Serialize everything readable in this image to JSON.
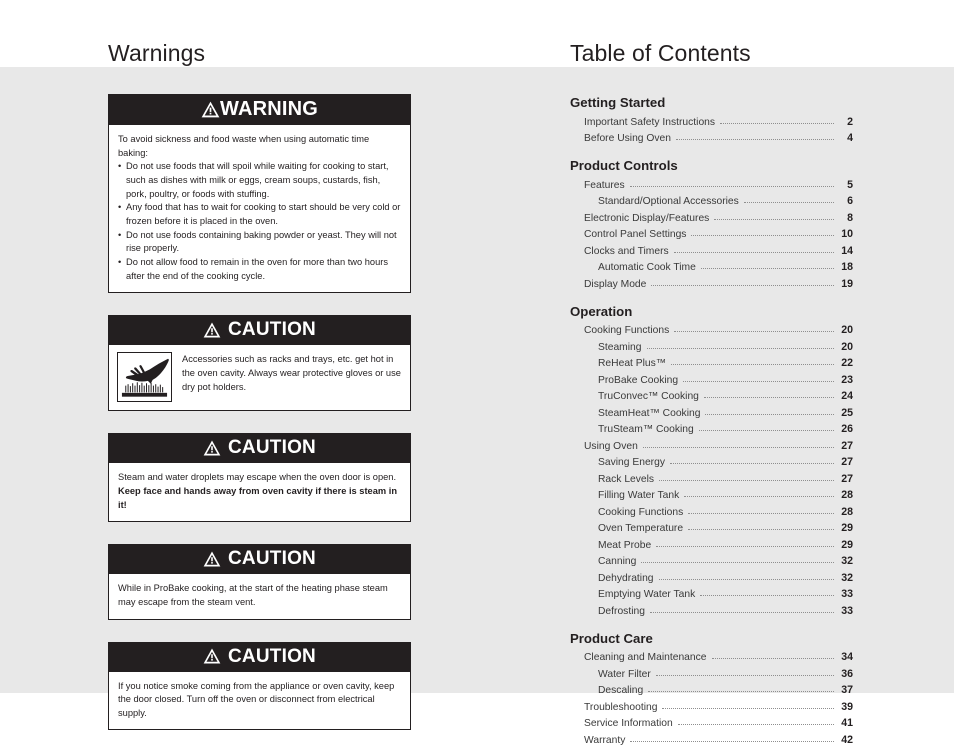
{
  "warnings": {
    "heading": "Warnings",
    "boxes": [
      {
        "level": "WARNING",
        "icon": "warning-triangle-icon",
        "intro": "To avoid sickness and food waste when using automatic time baking:",
        "bullets": [
          "Do not use foods that will spoil while waiting for cooking to start, such as dishes with milk or eggs, cream soups, custards, fish, pork, poultry, or foods with stuffing.",
          "Any food that has to wait for cooking to start should be very cold or frozen before it is placed in the oven.",
          "Do not use foods containing baking powder or yeast. They will not rise properly.",
          "Do not allow food to remain in the oven for more than two hours after the end of the cooking cycle."
        ]
      },
      {
        "level": "CAUTION",
        "icon": "warning-triangle-icon",
        "pictogram": "hot-surface-hand-icon",
        "text": "Accessories such as racks and trays, etc. get hot in the oven cavity. Always wear protective gloves or use dry pot holders."
      },
      {
        "level": "CAUTION",
        "icon": "warning-triangle-icon",
        "text_before": "Steam and water droplets may escape when the oven door is open. ",
        "text_bold": "Keep face and hands away from oven cavity if there is steam in it!"
      },
      {
        "level": "CAUTION",
        "icon": "warning-triangle-icon",
        "text": "While in ProBake cooking, at the start of the heating phase steam may escape from the steam vent."
      },
      {
        "level": "CAUTION",
        "icon": "warning-triangle-icon",
        "text": "If you notice smoke coming from the appliance or oven cavity, keep the door closed. Turn off the oven or disconnect from electrical supply."
      }
    ]
  },
  "toc": {
    "heading": "Table of Contents",
    "sections": [
      {
        "title": "Getting Started",
        "entries": [
          {
            "label": "Important Safety Instructions",
            "page": "2",
            "level": 1
          },
          {
            "label": "Before Using Oven",
            "page": "4",
            "level": 1
          }
        ]
      },
      {
        "title": "Product Controls",
        "entries": [
          {
            "label": "Features",
            "page": "5",
            "level": 1
          },
          {
            "label": "Standard/Optional Accessories",
            "page": "6",
            "level": 2
          },
          {
            "label": "Electronic Display/Features",
            "page": "8",
            "level": 1
          },
          {
            "label": "Control Panel Settings",
            "page": "10",
            "level": 1
          },
          {
            "label": "Clocks and Timers",
            "page": "14",
            "level": 1
          },
          {
            "label": "Automatic Cook Time",
            "page": "18",
            "level": 2
          },
          {
            "label": "Display Mode",
            "page": "19",
            "level": 1
          }
        ]
      },
      {
        "title": "Operation",
        "entries": [
          {
            "label": "Cooking Functions",
            "page": "20",
            "level": 1
          },
          {
            "label": "Steaming",
            "page": "20",
            "level": 2
          },
          {
            "label": "ReHeat Plus™",
            "page": "22",
            "level": 2
          },
          {
            "label": "ProBake Cooking",
            "page": "23",
            "level": 2
          },
          {
            "label": "TruConvec™ Cooking",
            "page": "24",
            "level": 2
          },
          {
            "label": "SteamHeat™ Cooking",
            "page": "25",
            "level": 2
          },
          {
            "label": "TruSteam™ Cooking",
            "page": "26",
            "level": 2
          },
          {
            "label": "Using Oven",
            "page": "27",
            "level": 1
          },
          {
            "label": "Saving Energy",
            "page": "27",
            "level": 2
          },
          {
            "label": "Rack Levels",
            "page": "27",
            "level": 2
          },
          {
            "label": "Filling Water Tank",
            "page": "28",
            "level": 2
          },
          {
            "label": "Cooking Functions",
            "page": "28",
            "level": 2
          },
          {
            "label": "Oven Temperature",
            "page": "29",
            "level": 2
          },
          {
            "label": "Meat Probe",
            "page": "29",
            "level": 2
          },
          {
            "label": "Canning",
            "page": "32",
            "level": 2
          },
          {
            "label": "Dehydrating",
            "page": "32",
            "level": 2
          },
          {
            "label": "Emptying Water Tank",
            "page": "33",
            "level": 2
          },
          {
            "label": "Defrosting",
            "page": "33",
            "level": 2
          }
        ]
      },
      {
        "title": "Product Care",
        "entries": [
          {
            "label": "Cleaning and Maintenance",
            "page": "34",
            "level": 1
          },
          {
            "label": "Water Filter",
            "page": "36",
            "level": 2
          },
          {
            "label": "Descaling",
            "page": "37",
            "level": 2
          },
          {
            "label": "Troubleshooting",
            "page": "39",
            "level": 1
          },
          {
            "label": "Service Information",
            "page": "41",
            "level": 1
          },
          {
            "label": "Warranty",
            "page": "42",
            "level": 1
          }
        ]
      }
    ]
  },
  "colors": {
    "page_background": "#ffffff",
    "band_background": "#e8e8e8",
    "alert_header_background": "#231f20",
    "text": "#231f20",
    "leader_line": "#8e8e8e"
  }
}
